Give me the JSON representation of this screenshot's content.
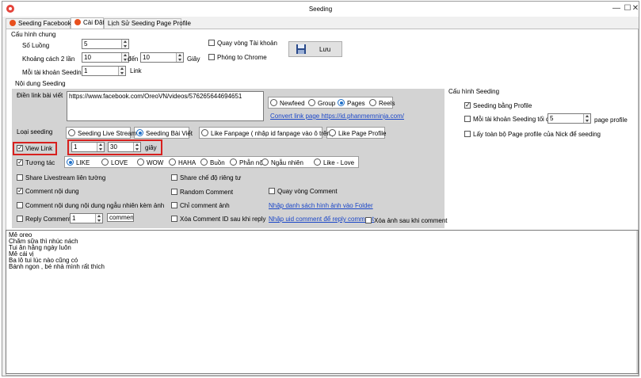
{
  "window": {
    "title": "Seeding",
    "minimize": "—",
    "maximize": "☐",
    "close": "✕"
  },
  "tabs": [
    {
      "label": "Seeding Facebook",
      "icon": "facebook-icon",
      "color": "#e8501e"
    },
    {
      "label": "Cài Đặt",
      "icon": "settings-icon",
      "color": "#e8501e"
    },
    {
      "label": "Lịch Sử Seeding Page Profile"
    }
  ],
  "general": {
    "legend": "Cấu hình chung",
    "threads_label": "Số Luồng",
    "threads_value": "5",
    "interval_label": "Khoảng cách 2 lần",
    "interval_from": "10",
    "interval_to_label": "đến",
    "interval_to": "10",
    "interval_unit": "Giây",
    "per_account_label": "Mỗi tài khoản Seeding",
    "per_account_value": "1",
    "per_account_unit": "Link",
    "rotate_accounts": "Quay vòng Tài khoản",
    "zoom_chrome": "Phóng to Chrome",
    "save_label": "Lưu"
  },
  "content": {
    "legend": "Nội dung Seeding",
    "link_label": "Điền link bài viết",
    "link_value": "https://www.facebook.com/OreoVN/videos/576265644694651",
    "source_options": [
      "Newfeed",
      "Group",
      "Pages",
      "Reels"
    ],
    "source_selected": 2,
    "convert_link": "Convert link page https://id.phanmemninja.com/",
    "type_label": "Loại seeding",
    "type_options": [
      "Seeding Live Stream",
      "Seeding Bài Viết",
      "Like Fanpage ( nhập id fanpage vào ô trên )",
      "Like Page Profile"
    ],
    "type_selected": 1,
    "view_link": "View Link",
    "view_from": "1",
    "view_to": "30",
    "view_unit": "giây",
    "interact": "Tương tác",
    "reactions": [
      "LIKE",
      "LOVE",
      "WOW",
      "HAHA",
      "Buồn",
      "Phẫn nộ",
      "Ngẫu nhiên",
      "Like - Love"
    ],
    "reaction_selected": 0,
    "share_livestream": "Share Livestream liên tường",
    "share_private": "Share chế độ riêng tư",
    "comment_content": "Comment nội dung",
    "random_comment": "Random Comment",
    "rotate_comment": "Quay vòng Comment",
    "comment_random_image": "Comment nội dung nội dung ngẫu nhiên kèm ảnh",
    "comment_image_only": "Chỉ comment ảnh",
    "image_folder_link": "Nhập danh sách hình ảnh vào Folder",
    "reply_comment": "Reply Comment",
    "reply_value": "1",
    "reply_unit": "comment",
    "delete_comment_id": "Xóa Comment ID sau khi reply",
    "uid_comment_link": "Nhập uid comment để reply comment",
    "delete_image": "Xóa ảnh sau khi comment"
  },
  "seeding_config": {
    "legend": "Cấu hình Seeding",
    "seeding_by_profile": "Seeding bằng Profile",
    "max_per_account": "Mỗi tài khoản Seeding tối đa",
    "max_value": "5",
    "max_unit": "page profile",
    "get_all_pages": "Lấy toàn bộ Page profile của Nick để seeding"
  },
  "comments": [
    "Mê oreo",
    "Chăm sữa thì nhúc nách",
    "Tui ăn hằng ngày luôn",
    "Mê cái vị",
    "Ba lô tui lúc nào cũng có",
    "Bánh ngon , bé nhà mình rất thích"
  ]
}
